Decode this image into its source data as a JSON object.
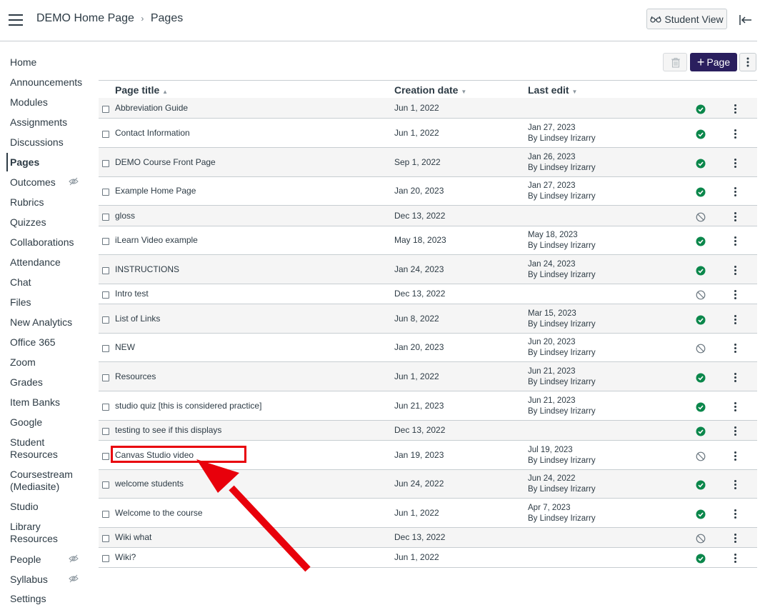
{
  "header": {
    "breadcrumb": [
      "DEMO Home Page",
      "Pages"
    ],
    "student_view_label": "Student View"
  },
  "sidebar": {
    "items": [
      {
        "label": "Home",
        "active": false,
        "hidden": false
      },
      {
        "label": "Announcements",
        "active": false,
        "hidden": false
      },
      {
        "label": "Modules",
        "active": false,
        "hidden": false
      },
      {
        "label": "Assignments",
        "active": false,
        "hidden": false
      },
      {
        "label": "Discussions",
        "active": false,
        "hidden": false
      },
      {
        "label": "Pages",
        "active": true,
        "hidden": false
      },
      {
        "label": "Outcomes",
        "active": false,
        "hidden": true
      },
      {
        "label": "Rubrics",
        "active": false,
        "hidden": false
      },
      {
        "label": "Quizzes",
        "active": false,
        "hidden": false
      },
      {
        "label": "Collaborations",
        "active": false,
        "hidden": false
      },
      {
        "label": "Attendance",
        "active": false,
        "hidden": false
      },
      {
        "label": "Chat",
        "active": false,
        "hidden": false
      },
      {
        "label": "Files",
        "active": false,
        "hidden": false
      },
      {
        "label": "New Analytics",
        "active": false,
        "hidden": false
      },
      {
        "label": "Office 365",
        "active": false,
        "hidden": false
      },
      {
        "label": "Zoom",
        "active": false,
        "hidden": false
      },
      {
        "label": "Grades",
        "active": false,
        "hidden": false
      },
      {
        "label": "Item Banks",
        "active": false,
        "hidden": false
      },
      {
        "label": "Google",
        "active": false,
        "hidden": false
      },
      {
        "label": "Student\nResources",
        "active": false,
        "hidden": false
      },
      {
        "label": "Coursestream\n(Mediasite)",
        "active": false,
        "hidden": false
      },
      {
        "label": "Studio",
        "active": false,
        "hidden": false
      },
      {
        "label": "Library\nResources",
        "active": false,
        "hidden": false
      },
      {
        "label": "People",
        "active": false,
        "hidden": true
      },
      {
        "label": "Syllabus",
        "active": false,
        "hidden": true
      },
      {
        "label": "Settings",
        "active": false,
        "hidden": false
      }
    ]
  },
  "toolbar": {
    "add_page_label": "Page"
  },
  "table": {
    "columns": [
      "Page title",
      "Creation date",
      "Last edit"
    ],
    "rows": [
      {
        "title": "Abbreviation Guide",
        "created": "Jun 1, 2022",
        "edited": "",
        "by": "",
        "published": true
      },
      {
        "title": "Contact Information",
        "created": "Jun 1, 2022",
        "edited": "Jan 27, 2023",
        "by": "By Lindsey Irizarry",
        "published": true
      },
      {
        "title": "DEMO Course Front Page",
        "created": "Sep 1, 2022",
        "edited": "Jan 26, 2023",
        "by": "By Lindsey Irizarry",
        "published": true
      },
      {
        "title": "Example Home Page",
        "created": "Jan 20, 2023",
        "edited": "Jan 27, 2023",
        "by": "By Lindsey Irizarry",
        "published": true
      },
      {
        "title": "gloss",
        "created": "Dec 13, 2022",
        "edited": "",
        "by": "",
        "published": false
      },
      {
        "title": "iLearn Video example",
        "created": "May 18, 2023",
        "edited": "May 18, 2023",
        "by": "By Lindsey Irizarry",
        "published": true
      },
      {
        "title": "INSTRUCTIONS",
        "created": "Jan 24, 2023",
        "edited": "Jan 24, 2023",
        "by": "By Lindsey Irizarry",
        "published": true
      },
      {
        "title": "Intro test",
        "created": "Dec 13, 2022",
        "edited": "",
        "by": "",
        "published": false
      },
      {
        "title": "List of Links",
        "created": "Jun 8, 2022",
        "edited": "Mar 15, 2023",
        "by": "By Lindsey Irizarry",
        "published": true
      },
      {
        "title": "NEW",
        "created": "Jan 20, 2023",
        "edited": "Jun 20, 2023",
        "by": "By Lindsey Irizarry",
        "published": false
      },
      {
        "title": "Resources",
        "created": "Jun 1, 2022",
        "edited": "Jun 21, 2023",
        "by": "By Lindsey Irizarry",
        "published": true
      },
      {
        "title": "studio quiz [this is considered practice]",
        "created": "Jun 21, 2023",
        "edited": "Jun 21, 2023",
        "by": "By Lindsey Irizarry",
        "published": true
      },
      {
        "title": "testing to see if this displays",
        "created": "Dec 13, 2022",
        "edited": "",
        "by": "",
        "published": true
      },
      {
        "title": "Canvas Studio video",
        "created": "Jan 19, 2023",
        "edited": "Jul 19, 2023",
        "by": "By Lindsey Irizarry",
        "published": false
      },
      {
        "title": "welcome students",
        "created": "Jun 24, 2022",
        "edited": "Jun 24, 2022",
        "by": "By Lindsey Irizarry",
        "published": true
      },
      {
        "title": "Welcome to the course",
        "created": "Jun 1, 2022",
        "edited": "Apr 7, 2023",
        "by": "By Lindsey Irizarry",
        "published": true
      },
      {
        "title": "Wiki what",
        "created": "Dec 13, 2022",
        "edited": "",
        "by": "",
        "published": false
      },
      {
        "title": "Wiki?",
        "created": "Jun 1, 2022",
        "edited": "",
        "by": "",
        "published": true
      }
    ]
  },
  "colors": {
    "primary_button": "#2a1f5e",
    "published": "#0b874b",
    "unpublished": "#6b7780",
    "annotation": "#e8000b"
  }
}
